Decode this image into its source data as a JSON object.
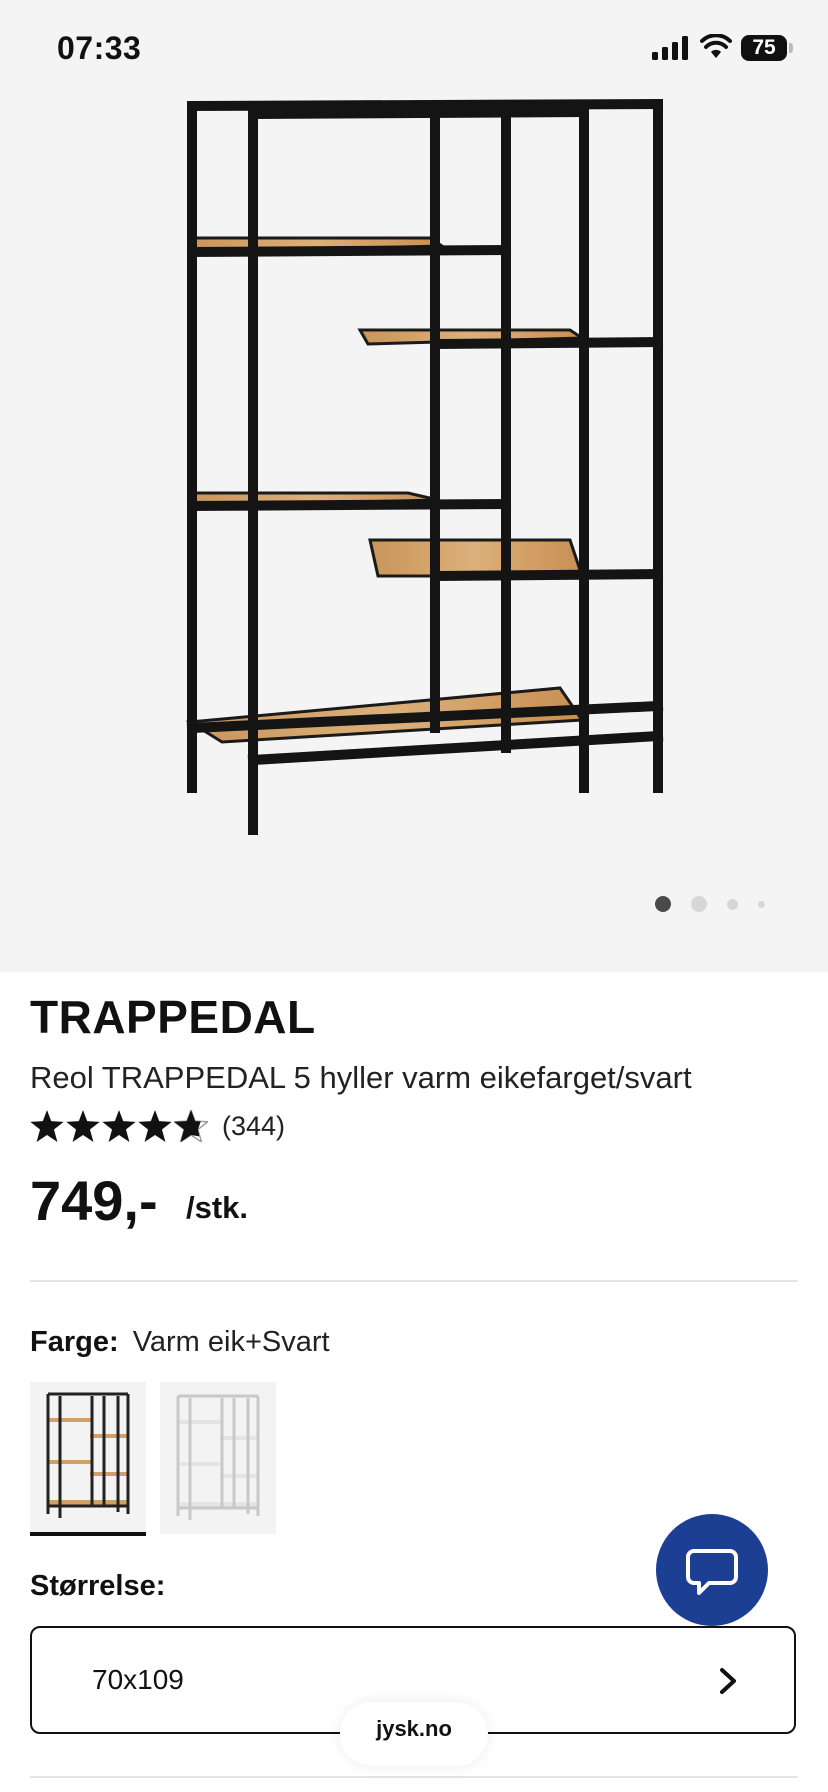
{
  "status_bar": {
    "time": "07:33",
    "battery": "75"
  },
  "gallery": {
    "slide_count": 4,
    "active_index": 0
  },
  "product": {
    "brand": "TRAPPEDAL",
    "name": "Reol TRAPPEDAL 5 hyller varm eikefarget/svart",
    "rating": 4.8,
    "review_count": "(344)",
    "price": "749,-",
    "unit": "/stk."
  },
  "color": {
    "label": "Farge:",
    "value": "Varm eik+Svart",
    "options": [
      {
        "name": "Varm eik+Svart",
        "selected": true
      },
      {
        "name": "white",
        "selected": false
      }
    ]
  },
  "size": {
    "label": "Størrelse:",
    "value": "70x109"
  },
  "browser": {
    "url": "jysk.no"
  },
  "colors": {
    "chat_button": "#1c3f94",
    "wood": "#d4a46a",
    "frame": "#1a1a1a"
  }
}
